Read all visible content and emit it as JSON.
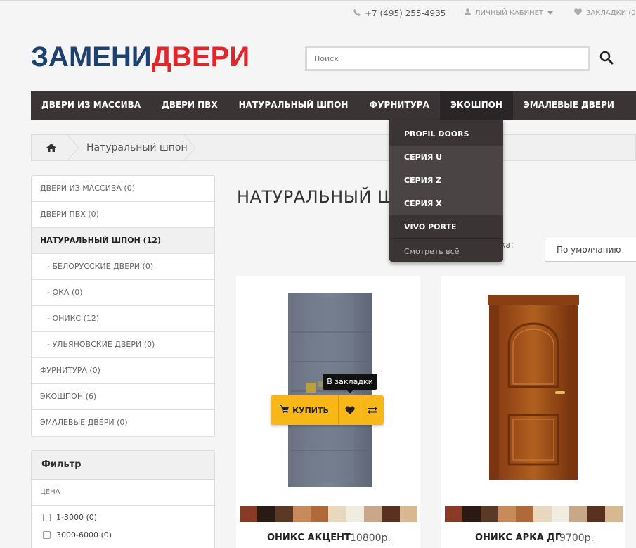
{
  "topbar": {
    "phone": "+7 (495) 255-4935",
    "account": "ЛИЧНЫЙ КАБИНЕТ",
    "wishlist": "ЗАКЛАДКИ (0)"
  },
  "logo": {
    "part1": "ЗАМЕНИ",
    "part2": "ДВЕРИ"
  },
  "search": {
    "placeholder": "Поиск"
  },
  "menu": {
    "items": [
      {
        "label": "ДВЕРИ ИЗ МАССИВА"
      },
      {
        "label": "ДВЕРИ ПВХ"
      },
      {
        "label": "НАТУРАЛЬНЫЙ ШПОН"
      },
      {
        "label": "ФУРНИТУРА"
      },
      {
        "label": "ЭКОШПОН"
      },
      {
        "label": "ЭМАЛЕВЫЕ ДВЕРИ"
      }
    ],
    "dropdown": {
      "items": [
        {
          "label": "PROFIL DOORS"
        },
        {
          "label": "СЕРИЯ U"
        },
        {
          "label": "СЕРИЯ Z"
        },
        {
          "label": "СЕРИЯ X"
        },
        {
          "label": "VIVO PORTE"
        }
      ],
      "see_all": "Смотреть всё"
    }
  },
  "breadcrumb": {
    "current": "Натуральный шпон"
  },
  "sidebar": {
    "categories": [
      {
        "label": "ДВЕРИ ИЗ МАССИВА (0)"
      },
      {
        "label": "ДВЕРИ ПВХ (0)"
      },
      {
        "label": "НАТУРАЛЬНЫЙ ШПОН (12)"
      },
      {
        "label": "- БЕЛОРУССКИЕ ДВЕРИ (0)"
      },
      {
        "label": "- ОКА (0)"
      },
      {
        "label": "- ОНИКС (12)"
      },
      {
        "label": "- УЛЬЯНОВСКИЕ ДВЕРИ (0)"
      },
      {
        "label": "ФУРНИТУРА (0)"
      },
      {
        "label": "ЭКОШПОН (6)"
      },
      {
        "label": "ЭМАЛЕВЫЕ ДВЕРИ (0)"
      }
    ],
    "filter": {
      "title": "Фильтр",
      "group": "ЦЕНА",
      "options": [
        {
          "label": "1-3000 (0)"
        },
        {
          "label": "3000-6000 (0)"
        }
      ]
    }
  },
  "main": {
    "title": "НАТУРАЛЬНЫЙ ШП",
    "sort_label": "вка:",
    "sort_value": "По умолчанию"
  },
  "products": [
    {
      "name": "ОНИКС АКЦЕНТ",
      "price": "10800р.",
      "buy_label": "КУПИТЬ",
      "tooltip": "В закладки"
    },
    {
      "name": "ОНИКС АРКА ДГ",
      "price": "9700р."
    }
  ],
  "swatch_colors": [
    "#8a3a26",
    "#2a1a14",
    "#5a3a26",
    "#c88a5a",
    "#b06a3a",
    "#e8d8c0",
    "#f0ece0",
    "#c8a888",
    "#5a3020",
    "#d8b890"
  ],
  "colors": {
    "menu_bg": "#3a3435",
    "accent_yellow": "#f7b716",
    "logo_blue": "#1f4170",
    "logo_red": "#e2262b"
  }
}
